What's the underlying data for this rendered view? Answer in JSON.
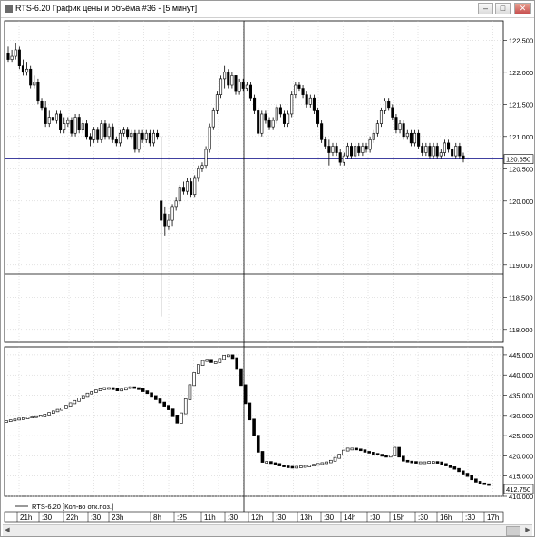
{
  "window": {
    "title": "RTS-6.20 График цены и объёма #36 - [5 минут]",
    "buttons": {
      "minimize": "‒",
      "maximize": "□",
      "close": "✕"
    }
  },
  "price_panel": {
    "y_ticks": [
      "122.500",
      "122.000",
      "121.500",
      "121.000",
      "120.500",
      "120.000",
      "119.500",
      "119.000",
      "118.500",
      "118.000"
    ],
    "current_value": "120.650",
    "current_value_y": 120.65
  },
  "indicator_panel": {
    "legend": "RTS-6.20 [Кол-во отк.поз.]",
    "y_ticks": [
      "445.000",
      "440.000",
      "435.000",
      "430.000",
      "425.000",
      "420.000",
      "415.000",
      "410.000"
    ],
    "current_value": "412.750"
  },
  "time_axis": {
    "labels": [
      "21h",
      ":30",
      "22h",
      ":30",
      "23h",
      "8h",
      ":25",
      "11h",
      ":30",
      "12h",
      ":30",
      "13h",
      ":30",
      "14h",
      ":30",
      "15h",
      ":30",
      "16h",
      ":30",
      "17h"
    ],
    "date_label": "15"
  },
  "colors": {
    "bull": "#ffffff",
    "bear": "#000000",
    "crosshair": "#000000",
    "price_line": "#000080",
    "grid": "#c8c8c8"
  },
  "chart_data": [
    {
      "type": "candlestick",
      "title": "",
      "ylim": [
        117.8,
        122.8
      ],
      "open": [
        122.3,
        122.2,
        122.25,
        122.35,
        122.1,
        122.0,
        122.05,
        121.8,
        121.85,
        121.55,
        121.45,
        121.2,
        121.3,
        121.25,
        121.35,
        121.1,
        121.2,
        121.25,
        121.05,
        121.3,
        121.1,
        121.2,
        121.0,
        120.95,
        121.1,
        120.95,
        121.2,
        121.0,
        121.15,
        120.95,
        120.9,
        121.05,
        121.1,
        121.0,
        121.05,
        120.8,
        121.05,
        120.95,
        121.05,
        120.9,
        121.05,
        120.0,
        119.8,
        119.6,
        119.7,
        119.9,
        120.0,
        120.2,
        120.15,
        120.3,
        120.1,
        120.35,
        120.5,
        120.55,
        120.8,
        121.15,
        121.4,
        121.65,
        121.9,
        122.0,
        121.8,
        121.95,
        121.7,
        121.85,
        121.75,
        121.8,
        121.6,
        121.4,
        121.05,
        121.35,
        121.25,
        121.15,
        121.25,
        121.45,
        121.35,
        121.2,
        121.35,
        121.65,
        121.8,
        121.75,
        121.65,
        121.5,
        121.6,
        121.4,
        121.2,
        120.95,
        120.85,
        120.75,
        120.85,
        120.75,
        120.6,
        120.7,
        120.85,
        120.7,
        120.85,
        120.75,
        120.85,
        120.8,
        120.95,
        121.05,
        121.2,
        121.4,
        121.55,
        121.45,
        121.3,
        121.1,
        121.2,
        121.0,
        121.05,
        120.9,
        121.05,
        120.85,
        120.75,
        120.85,
        120.7,
        120.85,
        120.7,
        120.75,
        120.9,
        120.8,
        120.7,
        120.85,
        120.7
      ],
      "close": [
        122.2,
        122.25,
        122.35,
        122.1,
        122.0,
        122.05,
        121.8,
        121.85,
        121.55,
        121.45,
        121.2,
        121.3,
        121.25,
        121.35,
        121.1,
        121.2,
        121.25,
        121.05,
        121.3,
        121.1,
        121.2,
        121.0,
        120.95,
        121.1,
        120.95,
        121.2,
        121.0,
        121.15,
        120.95,
        120.9,
        121.05,
        121.1,
        121.0,
        121.05,
        120.8,
        121.05,
        120.95,
        121.05,
        120.9,
        121.05,
        121.0,
        119.7,
        119.6,
        119.7,
        119.9,
        120.0,
        120.2,
        120.15,
        120.3,
        120.1,
        120.35,
        120.5,
        120.55,
        120.8,
        121.15,
        121.4,
        121.65,
        121.9,
        122.0,
        121.8,
        121.95,
        121.7,
        121.85,
        121.75,
        121.8,
        121.6,
        121.4,
        121.05,
        121.35,
        121.25,
        121.15,
        121.25,
        121.45,
        121.35,
        121.2,
        121.35,
        121.65,
        121.8,
        121.75,
        121.65,
        121.5,
        121.6,
        121.4,
        121.2,
        120.95,
        120.85,
        120.75,
        120.85,
        120.75,
        120.6,
        120.7,
        120.85,
        120.7,
        120.85,
        120.75,
        120.85,
        120.8,
        120.95,
        121.05,
        121.2,
        121.4,
        121.55,
        121.45,
        121.3,
        121.1,
        121.2,
        121.0,
        121.05,
        120.9,
        121.05,
        120.85,
        120.75,
        120.85,
        120.7,
        120.85,
        120.7,
        120.75,
        120.9,
        120.8,
        120.7,
        120.85,
        120.7,
        120.65
      ],
      "high": [
        122.4,
        122.35,
        122.45,
        122.4,
        122.2,
        122.15,
        122.1,
        121.95,
        121.9,
        121.6,
        121.55,
        121.4,
        121.4,
        121.4,
        121.4,
        121.3,
        121.3,
        121.3,
        121.35,
        121.35,
        121.25,
        121.25,
        121.05,
        121.15,
        121.15,
        121.25,
        121.25,
        121.2,
        121.2,
        121.0,
        121.1,
        121.15,
        121.15,
        121.1,
        121.1,
        121.1,
        121.1,
        121.1,
        121.1,
        121.1,
        121.1,
        121.0,
        119.9,
        119.8,
        119.95,
        120.05,
        120.25,
        120.3,
        120.35,
        120.35,
        120.4,
        120.55,
        120.6,
        120.85,
        121.2,
        121.45,
        121.7,
        121.95,
        122.1,
        122.05,
        122.0,
        121.95,
        121.9,
        121.9,
        121.85,
        121.85,
        121.65,
        121.45,
        121.4,
        121.4,
        121.3,
        121.3,
        121.5,
        121.5,
        121.4,
        121.4,
        121.7,
        121.85,
        121.85,
        121.8,
        121.7,
        121.65,
        121.65,
        121.45,
        121.25,
        121.0,
        120.95,
        120.9,
        120.9,
        120.8,
        120.75,
        120.9,
        120.9,
        120.9,
        120.9,
        120.9,
        120.9,
        121.0,
        121.1,
        121.25,
        121.45,
        121.6,
        121.6,
        121.5,
        121.35,
        121.25,
        121.25,
        121.1,
        121.1,
        121.1,
        121.1,
        120.9,
        120.9,
        120.9,
        120.9,
        120.9,
        120.8,
        120.95,
        120.95,
        120.85,
        120.9,
        120.9,
        120.75
      ],
      "low": [
        122.15,
        122.15,
        122.2,
        122.05,
        121.95,
        121.95,
        121.75,
        121.75,
        121.5,
        121.4,
        121.15,
        121.15,
        121.2,
        121.2,
        121.05,
        121.05,
        121.15,
        121.0,
        121.0,
        121.05,
        121.05,
        120.95,
        120.85,
        120.9,
        120.9,
        120.9,
        120.95,
        120.95,
        120.9,
        120.85,
        120.85,
        121.0,
        120.95,
        120.95,
        120.75,
        120.75,
        120.9,
        120.9,
        120.85,
        120.85,
        120.95,
        118.2,
        119.45,
        119.55,
        119.6,
        119.85,
        119.95,
        120.1,
        120.1,
        120.05,
        120.05,
        120.3,
        120.45,
        120.5,
        120.75,
        121.1,
        121.35,
        121.6,
        121.75,
        121.75,
        121.75,
        121.65,
        121.65,
        121.7,
        121.7,
        121.55,
        121.35,
        121.0,
        121.0,
        121.2,
        121.1,
        121.1,
        121.2,
        121.3,
        121.15,
        121.15,
        121.3,
        121.6,
        121.7,
        121.6,
        121.45,
        121.45,
        121.35,
        121.15,
        120.9,
        120.8,
        120.55,
        120.7,
        120.7,
        120.55,
        120.55,
        120.65,
        120.65,
        120.65,
        120.7,
        120.7,
        120.75,
        120.75,
        120.9,
        121.0,
        121.15,
        121.35,
        121.4,
        121.25,
        121.05,
        121.05,
        120.95,
        120.95,
        120.85,
        120.85,
        120.8,
        120.7,
        120.7,
        120.65,
        120.65,
        120.65,
        120.65,
        120.7,
        120.75,
        120.65,
        120.65,
        120.65,
        120.6
      ]
    },
    {
      "type": "line",
      "title": "",
      "ylim": [
        410,
        447
      ],
      "values": [
        428.6,
        428.8,
        429.0,
        429.2,
        429.3,
        429.5,
        429.7,
        429.8,
        430.0,
        430.2,
        430.6,
        431.0,
        431.4,
        431.8,
        432.4,
        433.0,
        433.6,
        434.2,
        434.8,
        435.4,
        435.8,
        436.2,
        436.5,
        436.8,
        436.8,
        436.5,
        436.2,
        436.4,
        436.8,
        437.0,
        436.8,
        436.5,
        436.0,
        435.5,
        434.8,
        434.0,
        433.2,
        432.4,
        431.5,
        430.0,
        428.2,
        430.5,
        434.0,
        437.5,
        440.5,
        442.5,
        443.5,
        443.8,
        443.2,
        443.2,
        444.0,
        444.8,
        444.9,
        444.2,
        441.5,
        437.5,
        433.0,
        429.0,
        425.0,
        421.0,
        418.5,
        418.5,
        418.2,
        418.0,
        417.6,
        417.4,
        417.3,
        417.2,
        417.3,
        417.4,
        417.5,
        417.6,
        417.8,
        418.0,
        418.2,
        418.4,
        418.8,
        419.5,
        420.3,
        421.3,
        421.8,
        421.8,
        421.6,
        421.4,
        421.0,
        420.8,
        420.5,
        420.3,
        420.0,
        419.8,
        420.1,
        422.0,
        419.8,
        418.8,
        418.6,
        418.5,
        418.4,
        418.4,
        418.4,
        418.5,
        418.5,
        418.4,
        418.0,
        417.6,
        417.2,
        416.8,
        416.2,
        415.6,
        415.0,
        414.2,
        413.6,
        413.2,
        413.0,
        412.8
      ],
      "series": [
        {
          "name": "RTS-6.20 [Кол-во отк.поз.]"
        }
      ]
    }
  ]
}
